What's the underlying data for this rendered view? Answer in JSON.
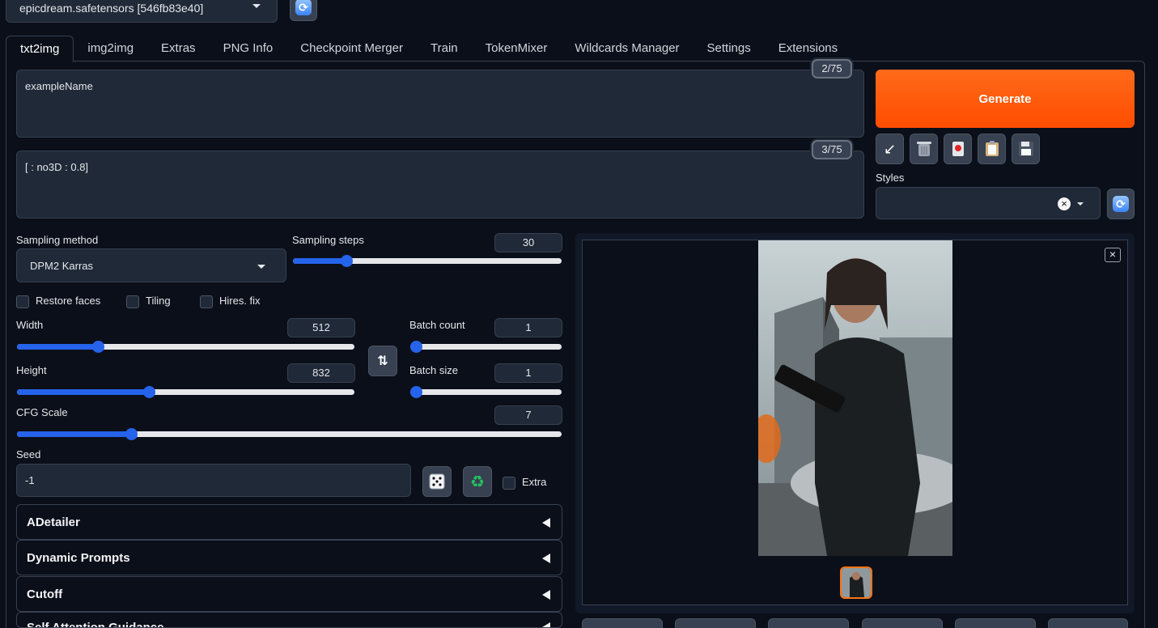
{
  "checkpoint": {
    "value": "epicdream.safetensors [546fb83e40]"
  },
  "tabs": [
    {
      "label": "txt2img",
      "active": true
    },
    {
      "label": "img2img"
    },
    {
      "label": "Extras"
    },
    {
      "label": "PNG Info"
    },
    {
      "label": "Checkpoint Merger"
    },
    {
      "label": "Train"
    },
    {
      "label": "TokenMixer"
    },
    {
      "label": "Wildcards Manager"
    },
    {
      "label": "Settings"
    },
    {
      "label": "Extensions"
    }
  ],
  "prompt": {
    "value": "exampleName",
    "tokens": "2/75"
  },
  "negative_prompt": {
    "value": "[ : no3D : 0.8]",
    "tokens": "3/75"
  },
  "generate": {
    "label": "Generate"
  },
  "styles": {
    "label": "Styles",
    "clear": "×"
  },
  "sampling": {
    "method_label": "Sampling method",
    "method_value": "DPM2 Karras",
    "steps_label": "Sampling steps",
    "steps_value": "30",
    "steps_fraction": 0.2
  },
  "checkboxes": {
    "restore_faces": "Restore faces",
    "tiling": "Tiling",
    "hires": "Hires. fix"
  },
  "width": {
    "label": "Width",
    "value": "512",
    "fraction": 0.24
  },
  "height": {
    "label": "Height",
    "value": "832",
    "fraction": 0.39
  },
  "batch_count": {
    "label": "Batch count",
    "value": "1",
    "fraction": 0.0
  },
  "batch_size": {
    "label": "Batch size",
    "value": "1",
    "fraction": 0.0
  },
  "cfg": {
    "label": "CFG Scale",
    "value": "7",
    "fraction": 0.21
  },
  "seed": {
    "label": "Seed",
    "value": "-1",
    "extra_label": "Extra"
  },
  "accordions": [
    "ADetailer",
    "Dynamic Prompts",
    "Cutoff",
    "Self Attention Guidance"
  ],
  "gallery": {
    "close": "×"
  },
  "icons": {
    "swap": "swap-dimensions-icon",
    "dice": "dice-icon",
    "recycle": "recycle-icon"
  }
}
